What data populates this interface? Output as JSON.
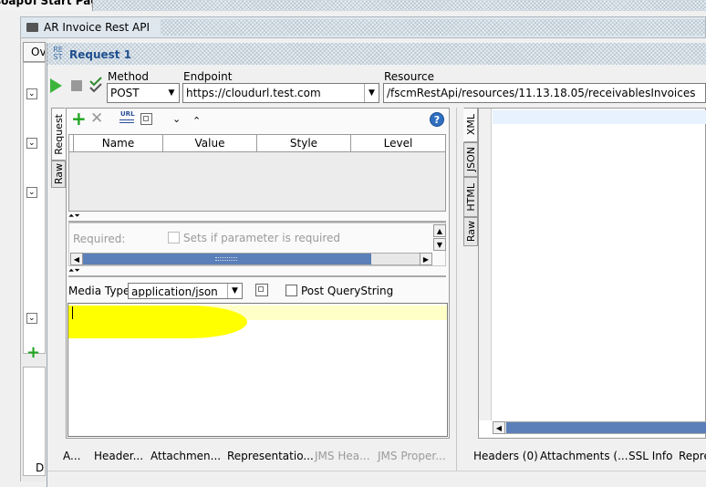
{
  "top_tab": {
    "title": "soapUI Start Page"
  },
  "project_window": {
    "title": "AR Invoice Rest API",
    "tab_label": "Ov",
    "footer_letter": "D"
  },
  "request_window": {
    "badge_top": "RE",
    "badge_bottom": "ST",
    "title": "Request 1"
  },
  "toolbar": {
    "method_label": "Method",
    "method_value": "POST",
    "endpoint_label": "Endpoint",
    "endpoint_value": "https://cloudurl.test.com",
    "resource_label": "Resource",
    "resource_value": "/fscmRestApi/resources/11.13.18.05/receivablesInvoices"
  },
  "left_tabs": {
    "request": "Request",
    "raw": "Raw"
  },
  "right_tabs": {
    "xml": "XML",
    "json": "JSON",
    "html": "HTML",
    "raw": "Raw"
  },
  "params": {
    "url_icon_text": "URL",
    "help_text": "?",
    "columns": [
      "Name",
      "Value",
      "Style",
      "Level"
    ],
    "required_label": "Required:",
    "required_hint": "Sets if parameter is required"
  },
  "media": {
    "label": "Media Type",
    "value": "application/json",
    "post_querystring_label": "Post QueryString"
  },
  "bottom_tabs_left": [
    "A...",
    "Header...",
    "Attachmen...",
    "Representatio...",
    "JMS Hea...",
    "JMS Proper..."
  ],
  "bottom_tabs_right": [
    "Headers (0)",
    "Attachments (...",
    "SSL Info",
    "Repre"
  ],
  "colors": {
    "highlight": "#ffff00",
    "title_blue": "#1f4f8f",
    "scroll_blue": "#5b7fb8"
  }
}
